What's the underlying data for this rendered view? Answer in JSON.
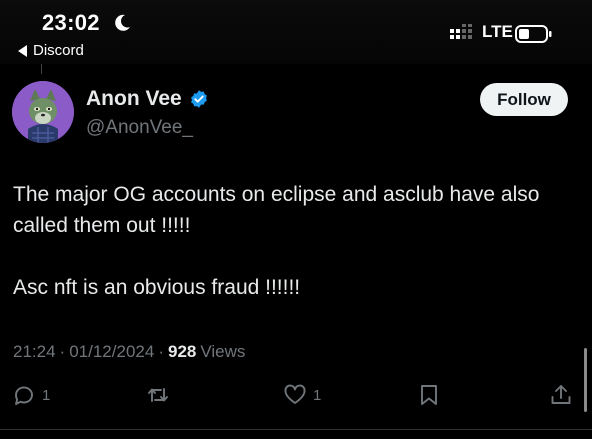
{
  "status_bar": {
    "time": "23:02",
    "back_label": "Discord",
    "network": "LTE",
    "icons": [
      "moon-icon",
      "signal-icon",
      "battery-icon"
    ]
  },
  "author": {
    "display_name": "Anon Vee",
    "handle": "@AnonVee_",
    "verified": true,
    "verified_color": "#1d9bf0",
    "avatar_bg": "#8b5cc7"
  },
  "follow_button": {
    "label": "Follow"
  },
  "tweet": {
    "paragraphs": [
      "The major OG accounts on eclipse and asclub have also called them out !!!!!",
      "Asc nft is an obvious fraud !!!!!!"
    ]
  },
  "meta": {
    "time": "21:24",
    "separator": "·",
    "date": "01/12/2024",
    "views_count": "928",
    "views_label": "Views"
  },
  "actions": {
    "reply_count": "1",
    "retweet_count": "",
    "like_count": "1"
  },
  "colors": {
    "background": "#000000",
    "primary_text": "#e7e9ea",
    "secondary_text": "#71767b",
    "follow_bg": "#eff3f4"
  }
}
